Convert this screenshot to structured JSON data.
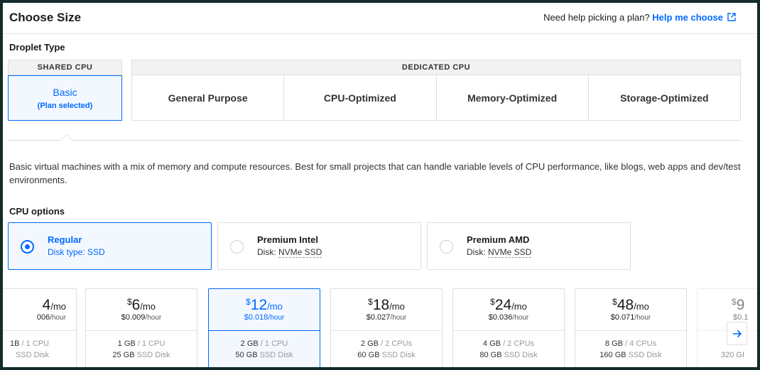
{
  "header": {
    "title": "Choose Size",
    "help_prefix": "Need help picking a plan?",
    "help_link": "Help me choose"
  },
  "droplet_type": {
    "label": "Droplet Type",
    "shared_header": "SHARED CPU",
    "dedicated_header": "DEDICATED CPU",
    "basic_label": "Basic",
    "basic_sub": "(Plan selected)",
    "dedicated_tabs": [
      "General Purpose",
      "CPU-Optimized",
      "Memory-Optimized",
      "Storage-Optimized"
    ]
  },
  "description": "Basic virtual machines with a mix of memory and compute resources. Best for small projects that can handle variable levels of CPU performance, like blogs, web apps and dev/test environments.",
  "cpu_options": {
    "label": "CPU options",
    "items": [
      {
        "name": "Regular",
        "disk_prefix": "Disk type: ",
        "disk": "SSD",
        "selected": true
      },
      {
        "name": "Premium Intel",
        "disk_prefix": "Disk: ",
        "disk": "NVMe SSD",
        "selected": false
      },
      {
        "name": "Premium AMD",
        "disk_prefix": "Disk: ",
        "disk": "NVMe SSD",
        "selected": false
      }
    ]
  },
  "plans": [
    {
      "currency": "",
      "amount": "4",
      "per": "/mo",
      "hourly": "006",
      "hour_unit": "/hour",
      "mem": "1B",
      "cpu": "/ 1 CPU",
      "disk": "",
      "disk_type": "SSD Disk",
      "selected": false
    },
    {
      "currency": "$",
      "amount": "6",
      "per": "/mo",
      "hourly": "$0.009",
      "hour_unit": "/hour",
      "mem": "1 GB",
      "cpu": "/ 1 CPU",
      "disk": "25 GB",
      "disk_type": "SSD Disk",
      "selected": false
    },
    {
      "currency": "$",
      "amount": "12",
      "per": "/mo",
      "hourly": "$0.018",
      "hour_unit": "/hour",
      "mem": "2 GB",
      "cpu": "/ 1 CPU",
      "disk": "50 GB",
      "disk_type": "SSD Disk",
      "selected": true
    },
    {
      "currency": "$",
      "amount": "18",
      "per": "/mo",
      "hourly": "$0.027",
      "hour_unit": "/hour",
      "mem": "2 GB",
      "cpu": "/ 2 CPUs",
      "disk": "60 GB",
      "disk_type": "SSD Disk",
      "selected": false
    },
    {
      "currency": "$",
      "amount": "24",
      "per": "/mo",
      "hourly": "$0.036",
      "hour_unit": "/hour",
      "mem": "4 GB",
      "cpu": "/ 2 CPUs",
      "disk": "80 GB",
      "disk_type": "SSD Disk",
      "selected": false
    },
    {
      "currency": "$",
      "amount": "48",
      "per": "/mo",
      "hourly": "$0.071",
      "hour_unit": "/hour",
      "mem": "8 GB",
      "cpu": "/ 4 CPUs",
      "disk": "160 GB",
      "disk_type": "SSD Disk",
      "selected": false
    },
    {
      "currency": "$",
      "amount": "9",
      "per": "",
      "hourly": "$0.1",
      "hour_unit": "",
      "mem": "",
      "cpu": "",
      "disk": "320 GI",
      "disk_type": "",
      "selected": false
    }
  ],
  "colors": {
    "accent": "#0069ff",
    "border": "#dedede",
    "selected_bg": "#f3f8ff"
  },
  "icons": {
    "external_link": "external-link-icon",
    "next": "arrow-right-icon"
  }
}
